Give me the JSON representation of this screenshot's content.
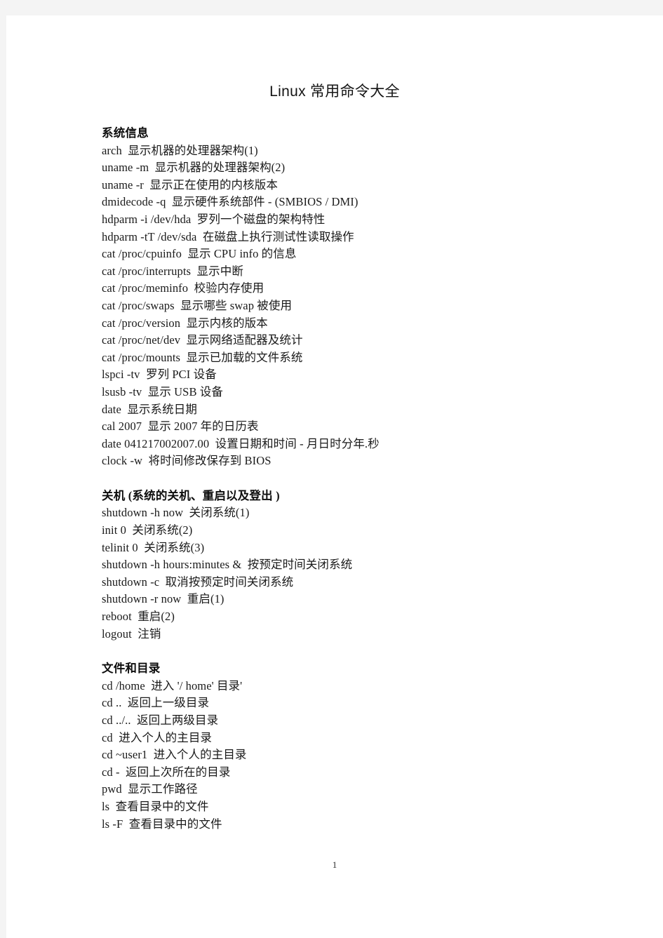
{
  "document": {
    "title": "Linux 常用命令大全",
    "page_number": "1",
    "sections": [
      {
        "heading": "系统信息",
        "lines": [
          "arch  显示机器的处理器架构(1)",
          "uname -m  显示机器的处理器架构(2)",
          "uname -r  显示正在使用的内核版本",
          "dmidecode -q  显示硬件系统部件 - (SMBIOS / DMI)",
          "hdparm -i /dev/hda  罗列一个磁盘的架构特性",
          "hdparm -tT /dev/sda  在磁盘上执行测试性读取操作",
          "cat /proc/cpuinfo  显示 CPU info 的信息",
          "cat /proc/interrupts  显示中断",
          "cat /proc/meminfo  校验内存使用",
          "cat /proc/swaps  显示哪些 swap 被使用",
          "cat /proc/version  显示内核的版本",
          "cat /proc/net/dev  显示网络适配器及统计",
          "cat /proc/mounts  显示已加载的文件系统",
          "lspci -tv  罗列 PCI 设备",
          "lsusb -tv  显示 USB 设备",
          "date  显示系统日期",
          "cal 2007  显示 2007 年的日历表",
          "date 041217002007.00  设置日期和时间 - 月日时分年.秒",
          "clock -w  将时间修改保存到 BIOS"
        ]
      },
      {
        "heading": "关机 (系统的关机、重启以及登出 )",
        "lines": [
          "shutdown -h now  关闭系统(1)",
          "init 0  关闭系统(2)",
          "telinit 0  关闭系统(3)",
          "shutdown -h hours:minutes &  按预定时间关闭系统",
          "shutdown -c  取消按预定时间关闭系统",
          "shutdown -r now  重启(1)",
          "reboot  重启(2)",
          "logout  注销"
        ]
      },
      {
        "heading": "文件和目录",
        "lines": [
          "cd /home  进入 '/ home' 目录'",
          "cd ..  返回上一级目录",
          "cd ../..  返回上两级目录",
          "cd  进入个人的主目录",
          "cd ~user1  进入个人的主目录",
          "cd -  返回上次所在的目录",
          "pwd  显示工作路径",
          "ls  查看目录中的文件",
          "ls -F  查看目录中的文件"
        ]
      }
    ]
  }
}
